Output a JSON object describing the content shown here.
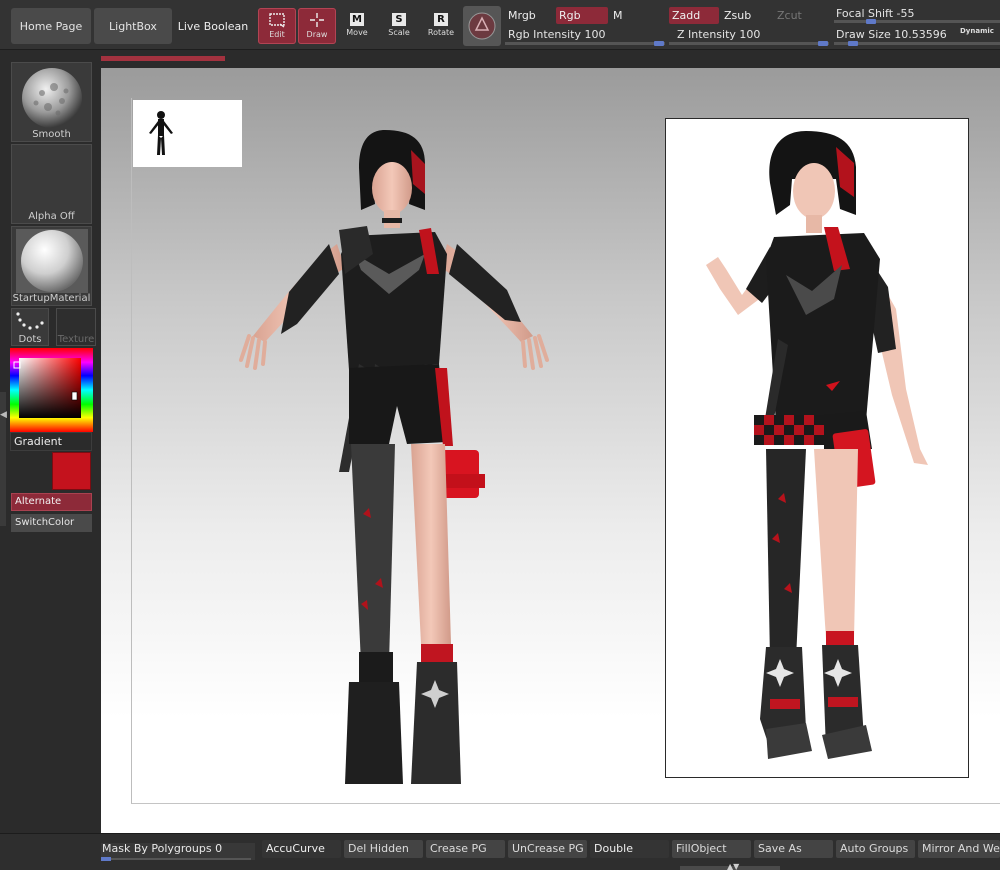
{
  "topbar": {
    "home_page": "Home Page",
    "lightbox": "LightBox",
    "live_boolean": "Live Boolean",
    "tools": {
      "edit": "Edit",
      "draw": "Draw",
      "move": "Move",
      "scale": "Scale",
      "rotate": "Rotate"
    },
    "tool_keys": {
      "move": "M",
      "scale": "S",
      "rotate": "R"
    },
    "modes": {
      "mrgb": "Mrgb",
      "rgb": "Rgb",
      "m": "M",
      "zadd": "Zadd",
      "zsub": "Zsub",
      "zcut": "Zcut"
    },
    "rgb_intensity": "Rgb Intensity 100",
    "z_intensity": "Z Intensity 100",
    "focal_shift": "Focal Shift -55",
    "draw_size": "Draw Size 10.53596",
    "dynamic": "Dynamic"
  },
  "shelf": {
    "smooth": "Smooth",
    "alpha": "Alpha Off",
    "material": "StartupMaterial",
    "stroke": "Dots",
    "texture": "Texture",
    "gradient": "Gradient",
    "alternate": "Alternate",
    "switchcolor": "SwitchColor"
  },
  "bottombar": {
    "mask_label": "Mask By Polygroups 0",
    "buttons": [
      "AccuCurve",
      "Del Hidden",
      "Crease PG",
      "UnCrease PG",
      "Double",
      "FillObject",
      "Save As",
      "Auto Groups",
      "Mirror And Weld"
    ]
  },
  "colors": {
    "accent": "#8d2a39",
    "main_color": "#c4121d",
    "slider_knob": "#5f79c8"
  },
  "icons": {
    "edit": "edit-icon",
    "draw": "draw-crosshair-icon",
    "material": "material-sphere-icon",
    "navigation": "figure-silhouette-icon"
  }
}
